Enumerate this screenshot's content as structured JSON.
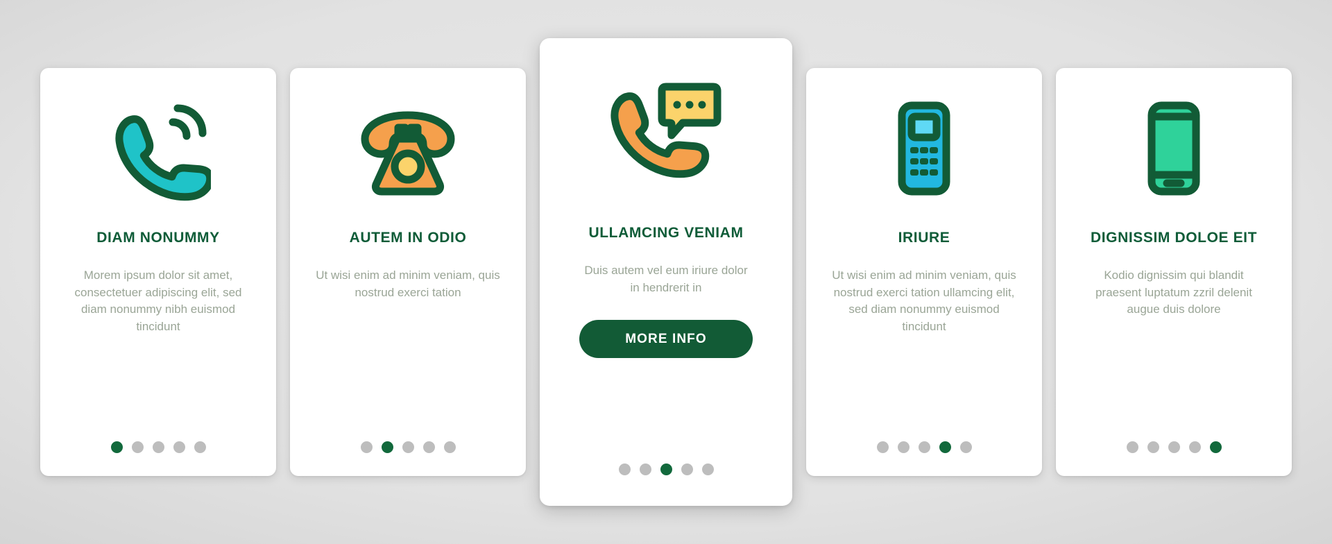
{
  "theme": {
    "dark_green": "#12693c",
    "outline_green": "#125b36",
    "title_green": "#0f5c38",
    "body_gray": "#9aa596",
    "dot_inactive": "#bdbdbd",
    "teal": "#1fc3c8",
    "cyan": "#22b8e0",
    "cyan_light": "#5fd9f5",
    "orange": "#f5a04c",
    "yellow": "#fbd36b",
    "mint": "#2fd29a",
    "card_bg": "#ffffff",
    "page_bg": "#d8d8d8"
  },
  "cards": [
    {
      "id": "card-1",
      "icon": "ringing-handset-icon",
      "title": "DIAM NONUMMY",
      "body": "Morem ipsum dolor sit amet, consectetuer adipiscing elit, sed diam nonummy nibh euismod tincidunt",
      "featured": false,
      "dots_total": 5,
      "active_dot": 1,
      "button_label": null
    },
    {
      "id": "card-2",
      "icon": "rotary-phone-icon",
      "title": "AUTEM IN ODIO",
      "body": "Ut wisi enim ad minim veniam, quis nostrud exerci tation",
      "featured": false,
      "dots_total": 5,
      "active_dot": 2,
      "button_label": null
    },
    {
      "id": "card-3",
      "icon": "handset-chat-icon",
      "title": "ULLAMCING VENIAM",
      "body": "Duis autem vel eum iriure dolor in hendrerit in",
      "featured": true,
      "dots_total": 5,
      "active_dot": 3,
      "button_label": "MORE INFO"
    },
    {
      "id": "card-4",
      "icon": "feature-phone-icon",
      "title": "IRIURE",
      "body": "Ut wisi enim ad minim veniam, quis nostrud exerci tation ullamcing elit, sed diam nonummy euismod tincidunt",
      "featured": false,
      "dots_total": 5,
      "active_dot": 4,
      "button_label": null
    },
    {
      "id": "card-5",
      "icon": "smartphone-icon",
      "title": "DIGNISSIM DOLOE EIT",
      "body": "Kodio dignissim qui blandit praesent luptatum zzril delenit augue duis dolore",
      "featured": false,
      "dots_total": 5,
      "active_dot": 5,
      "button_label": null
    }
  ]
}
